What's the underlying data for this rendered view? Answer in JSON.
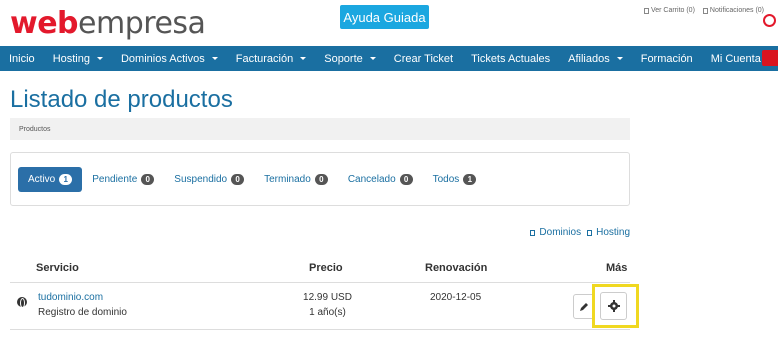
{
  "brand": {
    "logo_part1": "web",
    "logo_part2": "empresa"
  },
  "header": {
    "help_button": "Ayuda Guiada",
    "cart_label": "Ver Carrito (0)",
    "notifications_label": "Notificaciones (0)"
  },
  "nav": {
    "items": [
      {
        "label": "Inicio",
        "dropdown": false
      },
      {
        "label": "Hosting",
        "dropdown": true
      },
      {
        "label": "Dominios Activos",
        "dropdown": true
      },
      {
        "label": "Facturación",
        "dropdown": true
      },
      {
        "label": "Soporte",
        "dropdown": true
      },
      {
        "label": "Crear Ticket",
        "dropdown": false
      },
      {
        "label": "Tickets Actuales",
        "dropdown": false
      },
      {
        "label": "Afiliados",
        "dropdown": true
      },
      {
        "label": "Formación",
        "dropdown": false
      },
      {
        "label": "Mi Cuenta",
        "dropdown": true
      }
    ]
  },
  "page": {
    "title": "Listado de productos",
    "breadcrumb": "Productos"
  },
  "filters": [
    {
      "label": "Activo",
      "count": "1",
      "active": true
    },
    {
      "label": "Pendiente",
      "count": "0",
      "active": false
    },
    {
      "label": "Suspendido",
      "count": "0",
      "active": false
    },
    {
      "label": "Terminado",
      "count": "0",
      "active": false
    },
    {
      "label": "Cancelado",
      "count": "0",
      "active": false
    },
    {
      "label": "Todos",
      "count": "1",
      "active": false
    }
  ],
  "type_links": {
    "domains": "Dominios",
    "hosting": "Hosting"
  },
  "table": {
    "headers": {
      "service": "Servicio",
      "price": "Precio",
      "renewal": "Renovación",
      "more": "Más"
    },
    "rows": [
      {
        "domain": "tudominio.com",
        "description": "Registro de dominio",
        "price": "12.99 USD",
        "cycle": "1 año(s)",
        "renewal": "2020-12-05"
      }
    ]
  },
  "colors": {
    "brand_blue": "#1a6fa1",
    "brand_red": "#e3192c",
    "help_blue": "#1ba7e0",
    "highlight": "#f0d820"
  }
}
